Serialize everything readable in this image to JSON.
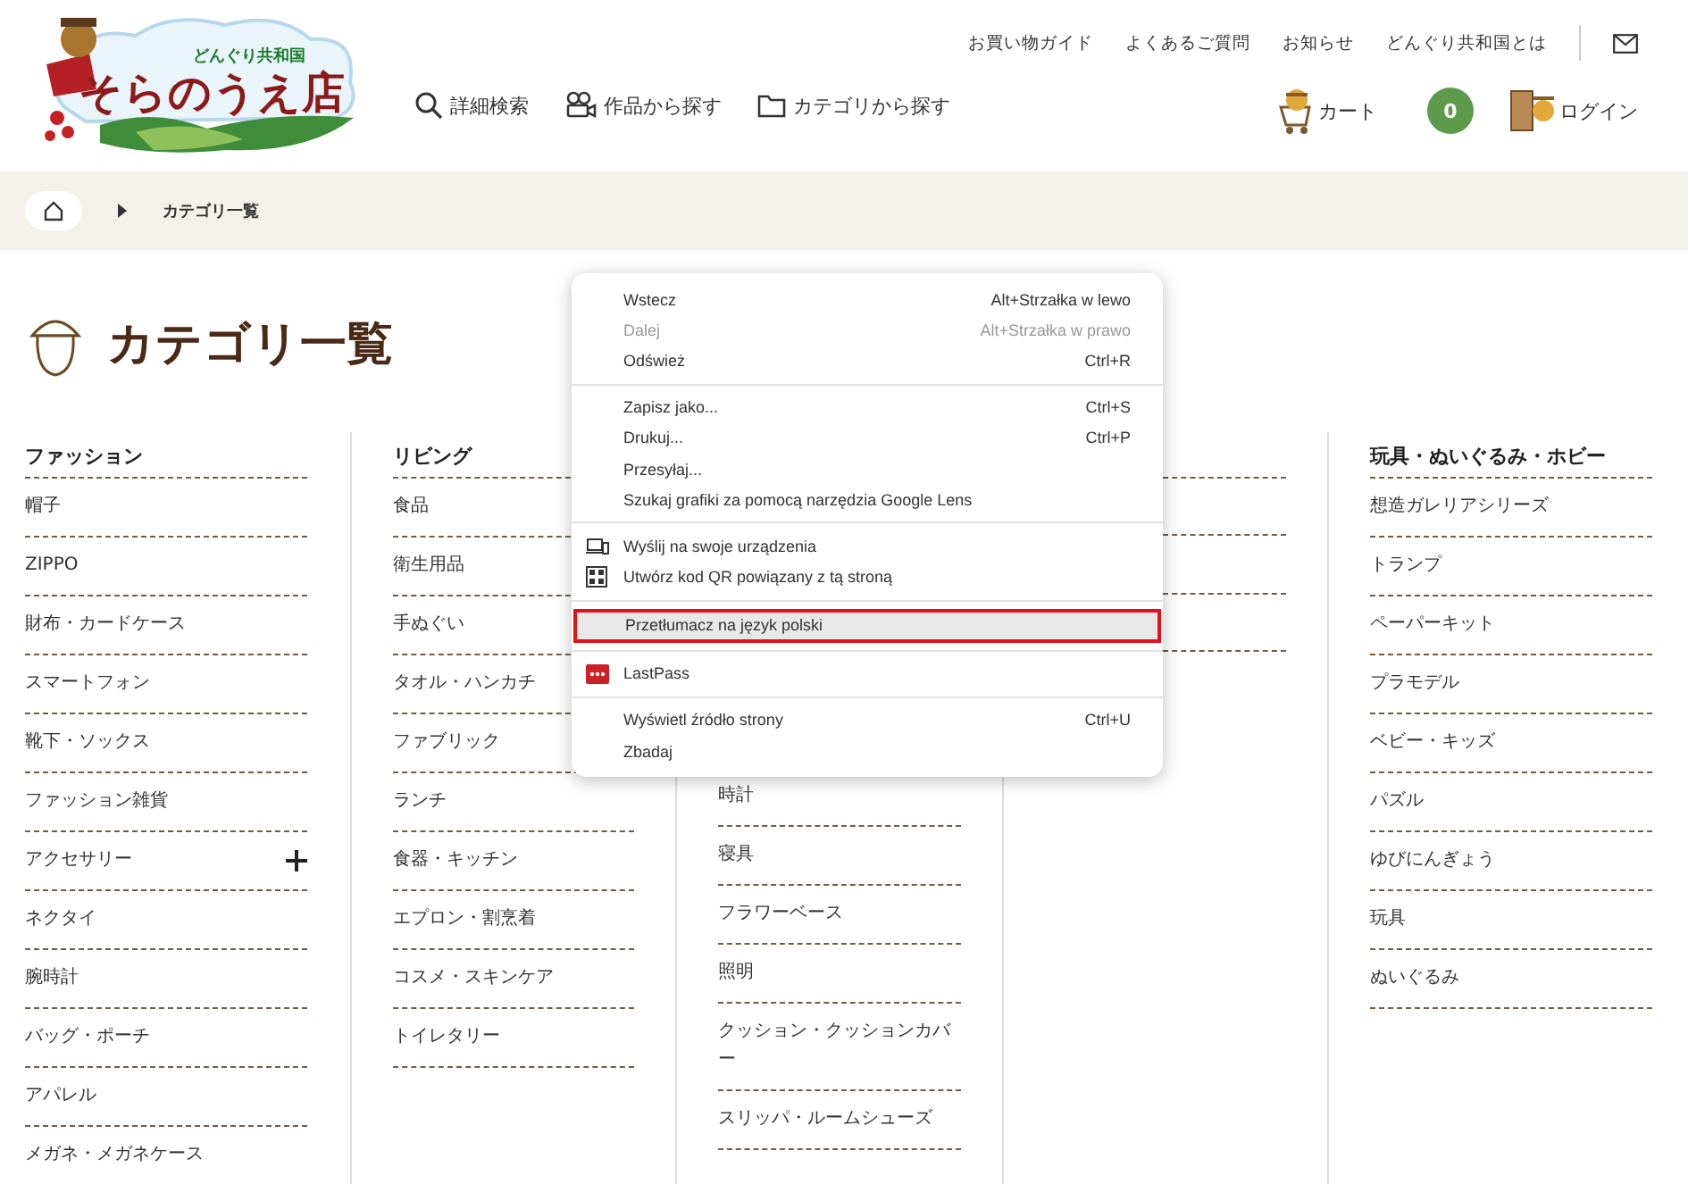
{
  "header": {
    "logo": {
      "subtitle": "どんぐり共和国",
      "title": "そらのうえ店"
    },
    "top_links": [
      "お買い物ガイド",
      "よくあるご質問",
      "お知らせ",
      "どんぐり共和国とは"
    ],
    "nav": [
      {
        "label": "詳細検索"
      },
      {
        "label": "作品から探す"
      },
      {
        "label": "カテゴリから探す"
      }
    ],
    "cart": {
      "label": "カート",
      "count": "0"
    },
    "login": {
      "label": "ログイン"
    }
  },
  "breadcrumb": {
    "current": "カテゴリ一覧"
  },
  "page_title": "カテゴリ一覧",
  "columns": [
    {
      "heading": "ファッション",
      "items": [
        {
          "label": "帽子"
        },
        {
          "label": "ZIPPO"
        },
        {
          "label": "財布・カードケース"
        },
        {
          "label": "スマートフォン"
        },
        {
          "label": "靴下・ソックス"
        },
        {
          "label": "ファッション雑貨"
        },
        {
          "label": "アクセサリー",
          "expandable": true
        },
        {
          "label": "ネクタイ"
        },
        {
          "label": "腕時計"
        },
        {
          "label": "バッグ・ポーチ"
        },
        {
          "label": "アパレル"
        },
        {
          "label": "メガネ・メガネケース"
        }
      ]
    },
    {
      "heading": "リビング",
      "items": [
        {
          "label": "食品"
        },
        {
          "label": "衛生用品"
        },
        {
          "label": "手ぬぐい"
        },
        {
          "label": "タオル・ハンカチ"
        },
        {
          "label": "ファブリック"
        },
        {
          "label": "ランチ"
        },
        {
          "label": "食器・キッチン"
        },
        {
          "label": "エプロン・割烹着"
        },
        {
          "label": "コスメ・スキンケア"
        },
        {
          "label": "トイレタリー"
        }
      ]
    },
    {
      "items": [
        {
          "label": "時計"
        },
        {
          "label": "寝具"
        },
        {
          "label": "フラワーベース"
        },
        {
          "label": "照明"
        },
        {
          "label": "クッション・クッションカバー"
        },
        {
          "label": "スリッパ・ルームシューズ"
        }
      ]
    },
    {},
    {
      "heading": "玩具・ぬいぐるみ・ホビー",
      "items": [
        {
          "label": "想造ガレリアシリーズ"
        },
        {
          "label": "トランプ"
        },
        {
          "label": "ペーパーキット"
        },
        {
          "label": "プラモデル"
        },
        {
          "label": "ベビー・キッズ"
        },
        {
          "label": "パズル"
        },
        {
          "label": "ゆびにんぎょう"
        },
        {
          "label": "玩具"
        },
        {
          "label": "ぬいぐるみ"
        }
      ]
    }
  ],
  "context_menu": [
    {
      "kind": "item",
      "label": "Wstecz",
      "shortcut": "Alt+Strzałka w lewo",
      "disabled": false,
      "selected": false
    },
    {
      "kind": "item",
      "label": "Dalej",
      "shortcut": "Alt+Strzałka w prawo",
      "disabled": true,
      "selected": false
    },
    {
      "kind": "item",
      "label": "Odśwież",
      "shortcut": "Ctrl+R",
      "disabled": false,
      "selected": false
    },
    {
      "kind": "separator"
    },
    {
      "kind": "item",
      "label": "Zapisz jako...",
      "shortcut": "Ctrl+S",
      "disabled": false,
      "selected": false
    },
    {
      "kind": "item",
      "label": "Drukuj...",
      "shortcut": "Ctrl+P",
      "disabled": false,
      "selected": false
    },
    {
      "kind": "item",
      "label": "Przesyłaj...",
      "disabled": false,
      "selected": false
    },
    {
      "kind": "item",
      "label": "Szukaj grafiki za pomocą narzędzia Google Lens",
      "disabled": false,
      "selected": false
    },
    {
      "kind": "separator"
    },
    {
      "kind": "devices",
      "label": "Wyślij na swoje urządzenia",
      "disabled": false,
      "selected": false
    },
    {
      "kind": "qr",
      "label": "Utwórz kod QR powiązany z tą stroną",
      "disabled": false,
      "selected": false
    },
    {
      "kind": "separator"
    },
    {
      "kind": "item",
      "label": "Przetłumacz na język polski",
      "disabled": false,
      "selected": true
    },
    {
      "kind": "separator"
    },
    {
      "kind": "extension",
      "label": "LastPass",
      "disabled": false,
      "selected": false
    },
    {
      "kind": "separator"
    },
    {
      "kind": "item",
      "label": "Wyświetl źródło strony",
      "shortcut": "Ctrl+U",
      "disabled": false,
      "selected": false
    },
    {
      "kind": "item",
      "label": "Zbadaj",
      "disabled": false,
      "selected": false
    }
  ]
}
